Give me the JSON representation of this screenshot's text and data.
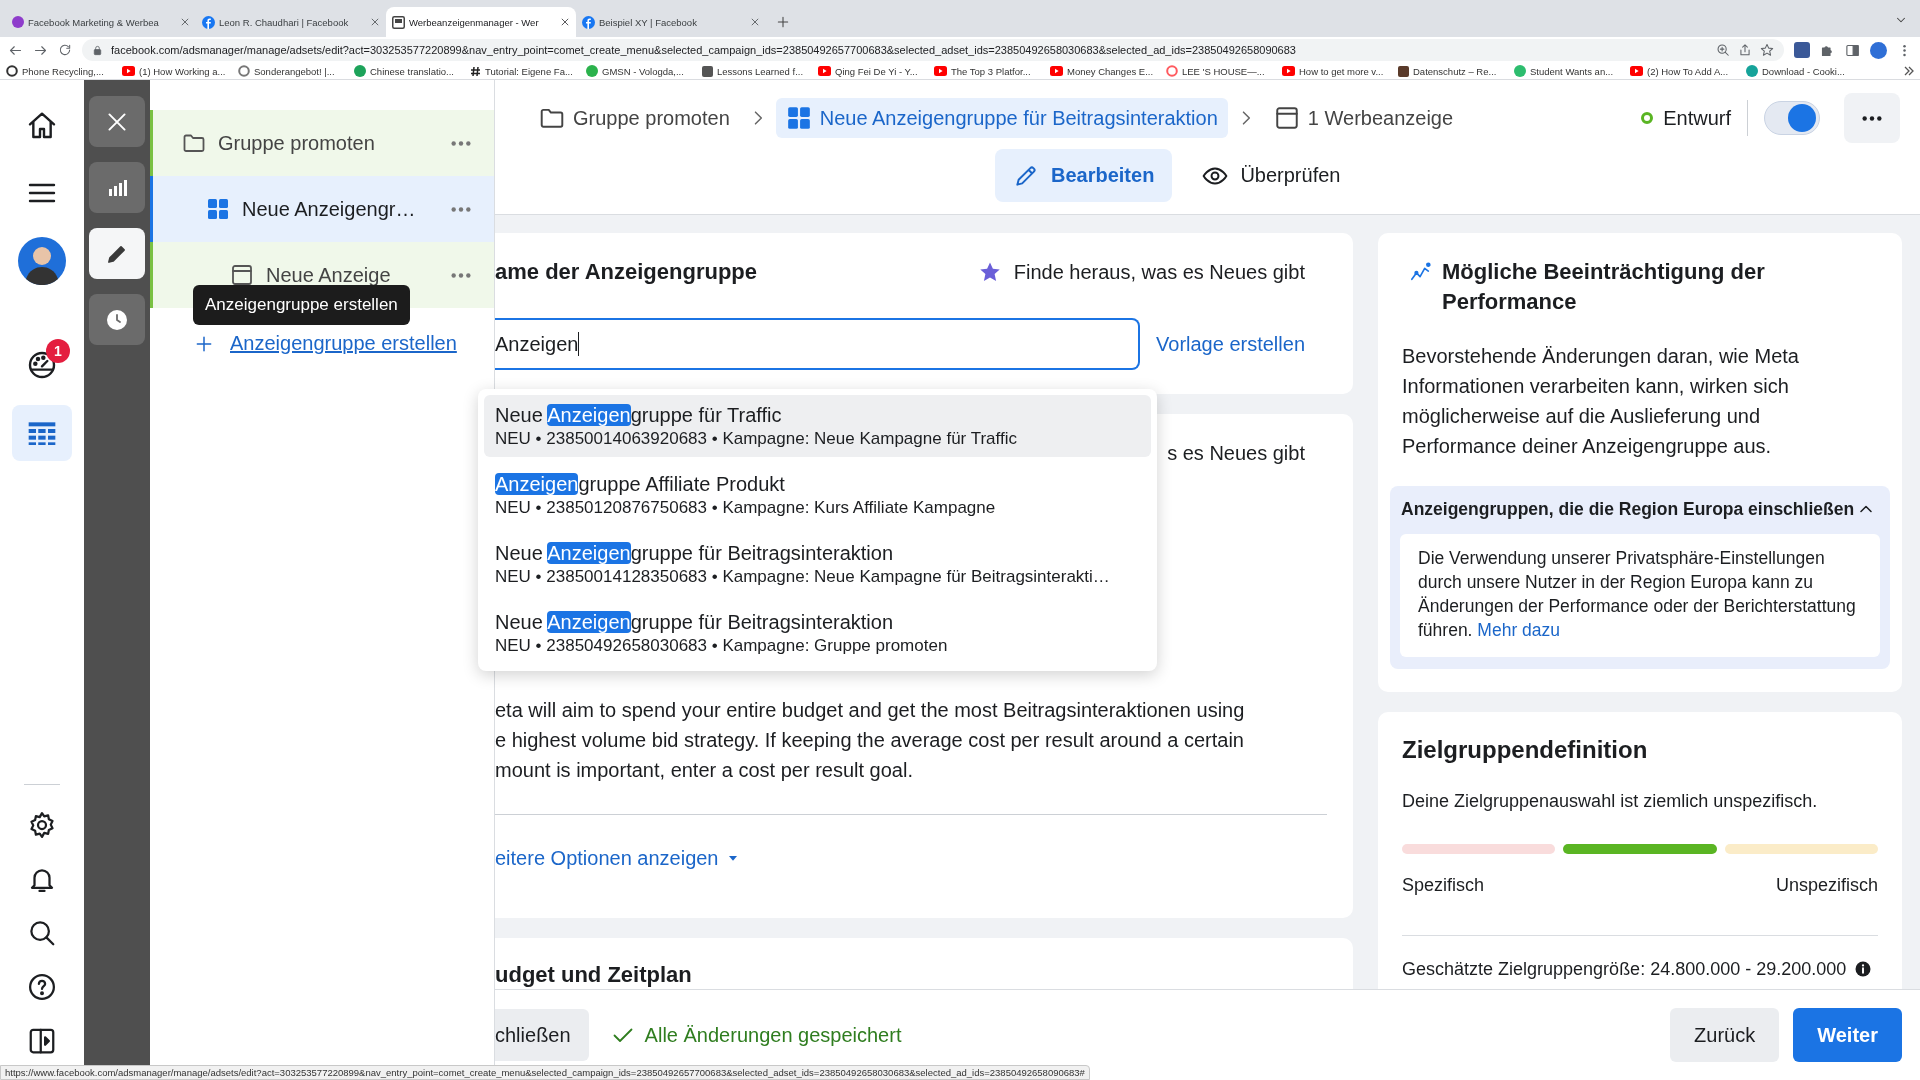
{
  "browser": {
    "tabs": [
      {
        "title": "Facebook Marketing & Werbea",
        "kind": "circle",
        "selected": false
      },
      {
        "title": "Leon R. Chaudhari | Facebook",
        "kind": "facebook",
        "selected": false
      },
      {
        "title": "Werbeanzeigenmanager - Wer",
        "kind": "page",
        "selected": true
      },
      {
        "title": "Beispiel XY | Facebook",
        "kind": "facebook",
        "selected": false
      }
    ],
    "url": "facebook.com/adsmanager/manage/adsets/edit?act=303253577220899&nav_entry_point=comet_create_menu&selected_campaign_ids=23850492657700683&selected_adset_ids=23850492658030683&selected_ad_ids=23850492658090683",
    "bookmarks": [
      {
        "label": "Phone Recycling,...",
        "kind": "ring",
        "color": "#333333"
      },
      {
        "label": "(1) How Working a...",
        "kind": "youtube",
        "color": "#ff0000"
      },
      {
        "label": "Sonderangebot! |...",
        "kind": "ring",
        "color": "#777777"
      },
      {
        "label": "Chinese translatio...",
        "kind": "circle",
        "color": "#1da35a"
      },
      {
        "label": "Tutorial: Eigene Fa...",
        "kind": "hash",
        "color": "#222222"
      },
      {
        "label": "GMSN - Vologda,...",
        "kind": "circle",
        "color": "#2bb24c"
      },
      {
        "label": "Lessons Learned f...",
        "kind": "square",
        "color": "#555555"
      },
      {
        "label": "Qing Fei De Yi - Y...",
        "kind": "youtube",
        "color": "#ff0000"
      },
      {
        "label": "The Top 3 Platfor...",
        "kind": "youtube",
        "color": "#ff0000"
      },
      {
        "label": "Money Changes E...",
        "kind": "youtube",
        "color": "#ff0000"
      },
      {
        "label": "LEE 'S HOUSE—...",
        "kind": "ring",
        "color": "#ff5a5f"
      },
      {
        "label": "How to get more v...",
        "kind": "youtube",
        "color": "#ff0000"
      },
      {
        "label": "Datenschutz – Re...",
        "kind": "square",
        "color": "#5a3a2a"
      },
      {
        "label": "Student Wants an...",
        "kind": "circle",
        "color": "#2dbd6e"
      },
      {
        "label": "(2) How To Add A...",
        "kind": "youtube",
        "color": "#ff0000"
      },
      {
        "label": "Download - Cooki...",
        "kind": "circle",
        "color": "#16a39a"
      }
    ]
  },
  "nav_rail": {
    "top": [
      {
        "kind": "home",
        "selected": false
      },
      {
        "kind": "menu",
        "selected": false
      },
      {
        "kind": "avatar",
        "selected": false
      },
      {
        "kind": "gauge",
        "selected": false,
        "badge": "1"
      },
      {
        "kind": "table",
        "selected": true
      }
    ],
    "bottom": [
      {
        "kind": "settings"
      },
      {
        "kind": "bell"
      },
      {
        "kind": "search"
      },
      {
        "kind": "help"
      },
      {
        "kind": "sidebar"
      }
    ]
  },
  "tool_column": [
    {
      "kind": "close",
      "selected": false
    },
    {
      "kind": "chart",
      "selected": false
    },
    {
      "kind": "edit",
      "selected": true
    },
    {
      "kind": "history",
      "selected": false
    }
  ],
  "tree": {
    "items": [
      {
        "kind": "campaign",
        "label": "Gruppe promoten",
        "selected": false,
        "children": [
          {
            "kind": "adset",
            "label": "Neue Anzeigengr…",
            "selected": true,
            "children": [
              {
                "kind": "ad",
                "label": "Neue Anzeige",
                "selected": false
              }
            ]
          }
        ]
      }
    ],
    "tooltip": "Anzeigengruppe erstellen",
    "create_link": "Anzeigengruppe erstellen"
  },
  "header": {
    "breadcrumbs": [
      {
        "kind": "campaign",
        "label": "Gruppe promoten",
        "selected": false
      },
      {
        "kind": "adset",
        "label": "Neue Anzeigengruppe für Beitragsinteraktion",
        "selected": true
      },
      {
        "kind": "ad",
        "label": "1 Werbeanzeige",
        "selected": false
      }
    ],
    "status": "Entwurf",
    "toggle": {
      "on": true
    },
    "modes": [
      {
        "kind": "edit",
        "label": "Bearbeiten",
        "selected": true
      },
      {
        "kind": "review",
        "label": "Überprüfen",
        "selected": false
      }
    ]
  },
  "name_card": {
    "title": "ame der Anzeigengruppe",
    "news_link": "Finde heraus, was es Neues gibt",
    "input_value": "Anzeigen",
    "template_link": "Vorlage erstellen"
  },
  "suggestions": [
    {
      "before": "Neue ",
      "match": "Anzeigen",
      "after": "gruppe für Traffic",
      "detail": "NEU • 23850014063920683 • Kampagne: Neue Kampagne für Traffic",
      "hovered": true
    },
    {
      "match": "Anzeigen",
      "after": "gruppe Affiliate Produkt",
      "detail": "NEU • 23850120876750683 • Kampagne: Kurs Affiliate Kampagne",
      "hovered": false
    },
    {
      "before": "Neue ",
      "match": "Anzeigen",
      "after": "gruppe für Beitragsinteraktion",
      "detail": "NEU • 23850014128350683 • Kampagne: Neue Kampagne für Beitragsinterakti…",
      "hovered": false
    },
    {
      "before": "Neue ",
      "match": "Anzeigen",
      "after": "gruppe für Beitragsinteraktion",
      "detail": "NEU • 23850492658030683 • Kampagne: Gruppe promoten",
      "hovered": false
    }
  ],
  "budget_card": {
    "news_link": "s es Neues gibt",
    "description_lines": [
      "eta will aim to spend your entire budget and get the most Beitragsinteraktionen using",
      "e highest volume bid strategy. If keeping the average cost per result around a certain",
      "mount is important, enter a cost per result goal."
    ],
    "more_options": "eitere Optionen anzeigen"
  },
  "schedule_card": {
    "title": "udget und Zeitplan"
  },
  "performance_card": {
    "title": "Mögliche Beeinträchtigung der Performance",
    "body": "Bevorstehende Änderungen daran, wie Meta Informationen verarbeiten kann, wirken sich möglicherweise auf die Auslieferung und Performance deiner Anzeigengruppe aus.",
    "notice": {
      "title": "Anzeigengruppen, die die Region Europa einschließen",
      "expanded": true,
      "text": "Die Verwendung unserer Privatsphäre-Einstellungen durch unsere Nutzer in der Region Europa kann zu Änderungen der Performance oder der Berichterstattung führen.",
      "link": "Mehr dazu"
    }
  },
  "audience_card": {
    "title": "Zielgruppendefinition",
    "summary": "Deine Zielgruppenauswahl ist ziemlich unspezifisch.",
    "scale": [
      {
        "color": "#f9dcdc"
      },
      {
        "color": "#5ab523"
      },
      {
        "color": "#fbecc8"
      }
    ],
    "left_label": "Spezifisch",
    "right_label": "Unspezifisch",
    "estimate": "Geschätzte Zielgruppengröße: 24.800.000 - 29.200.000"
  },
  "footer": {
    "close_button": "chließen",
    "saved": "Alle Änderungen gespeichert",
    "back": "Zurück",
    "next": "Weiter"
  },
  "status_url": "https://www.facebook.com/adsmanager/manage/adsets/edit?act=303253577220899&nav_entry_point=comet_create_menu&selected_campaign_ids=23850492657700683&selected_adset_ids=23850492658030683&selected_ad_ids=23850492658090683#"
}
